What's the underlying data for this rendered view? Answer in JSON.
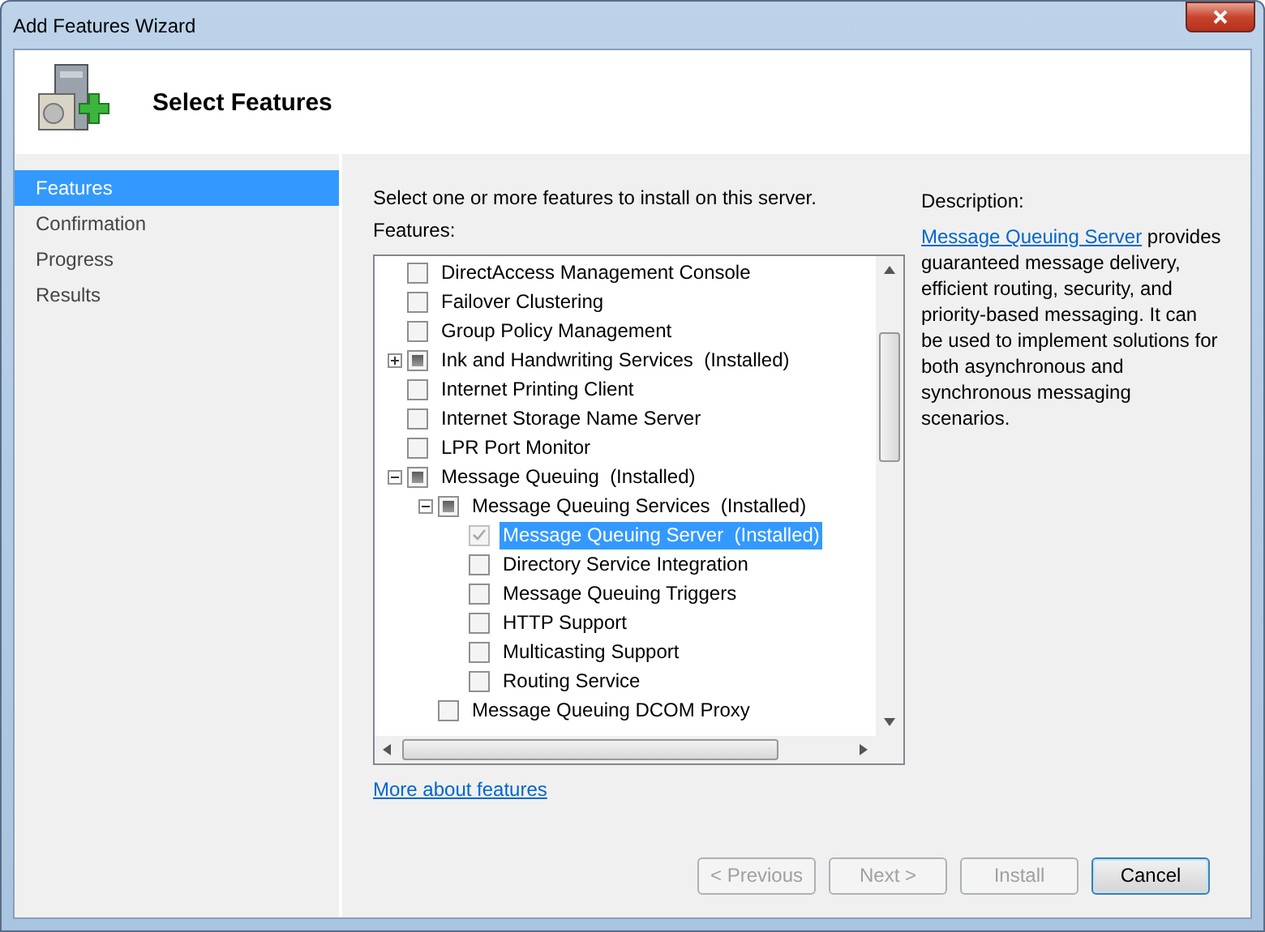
{
  "window": {
    "title": "Add Features Wizard"
  },
  "header": {
    "title": "Select Features"
  },
  "sidebar": {
    "items": [
      {
        "label": "Features",
        "selected": true
      },
      {
        "label": "Confirmation",
        "selected": false
      },
      {
        "label": "Progress",
        "selected": false
      },
      {
        "label": "Results",
        "selected": false
      }
    ]
  },
  "instruction": "Select one or more features to install on this server.",
  "features_label": "Features:",
  "tree": [
    {
      "label": "DirectAccess Management Console",
      "checked": false,
      "partial": false,
      "disabled": false,
      "selected": false
    },
    {
      "label": "Failover Clustering",
      "checked": false,
      "partial": false,
      "disabled": false,
      "selected": false
    },
    {
      "label": "Group Policy Management",
      "checked": false,
      "partial": false,
      "disabled": false,
      "selected": false
    },
    {
      "label": "Ink and Handwriting Services  (Installed)",
      "checked": false,
      "partial": true,
      "disabled": false,
      "selected": false,
      "expanded": false
    },
    {
      "label": "Internet Printing Client",
      "checked": false,
      "partial": false,
      "disabled": false,
      "selected": false
    },
    {
      "label": "Internet Storage Name Server",
      "checked": false,
      "partial": false,
      "disabled": false,
      "selected": false
    },
    {
      "label": "LPR Port Monitor",
      "checked": false,
      "partial": false,
      "disabled": false,
      "selected": false
    },
    {
      "label": "Message Queuing  (Installed)",
      "checked": false,
      "partial": true,
      "disabled": false,
      "selected": false,
      "expanded": true,
      "children": [
        {
          "label": "Message Queuing Services  (Installed)",
          "checked": false,
          "partial": true,
          "disabled": false,
          "selected": false,
          "expanded": true,
          "children": [
            {
              "label": "Message Queuing Server  (Installed)",
              "checked": true,
              "partial": false,
              "disabled": true,
              "selected": true
            },
            {
              "label": "Directory Service Integration",
              "checked": false,
              "partial": false,
              "disabled": false,
              "selected": false
            },
            {
              "label": "Message Queuing Triggers",
              "checked": false,
              "partial": false,
              "disabled": false,
              "selected": false
            },
            {
              "label": "HTTP Support",
              "checked": false,
              "partial": false,
              "disabled": false,
              "selected": false
            },
            {
              "label": "Multicasting Support",
              "checked": false,
              "partial": false,
              "disabled": false,
              "selected": false
            },
            {
              "label": "Routing Service",
              "checked": false,
              "partial": false,
              "disabled": false,
              "selected": false
            }
          ]
        },
        {
          "label": "Message Queuing DCOM Proxy",
          "checked": false,
          "partial": false,
          "disabled": false,
          "selected": false
        }
      ]
    }
  ],
  "description": {
    "heading": "Description:",
    "link": "Message Queuing Server",
    "text": " provides guaranteed message delivery, efficient routing, security, and priority-based messaging. It can be used to implement solutions for both asynchronous and synchronous messaging scenarios."
  },
  "more_link": "More about features",
  "buttons": [
    {
      "label": "< Previous",
      "disabled": true,
      "default": false
    },
    {
      "label": "Next >",
      "disabled": true,
      "default": false
    },
    {
      "label": "Install",
      "disabled": true,
      "default": false
    },
    {
      "label": "Cancel",
      "disabled": false,
      "default": true
    }
  ]
}
